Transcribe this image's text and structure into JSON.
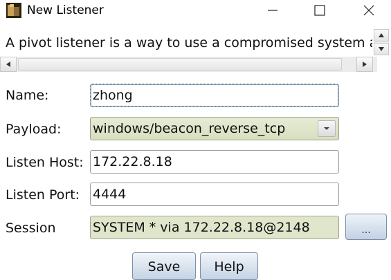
{
  "window": {
    "title": "New Listener"
  },
  "description": {
    "text": "A pivot listener is a way to use a compromised system as"
  },
  "form": {
    "name_label": "Name:",
    "name_value": "zhong",
    "payload_label": "Payload:",
    "payload_value": "windows/beacon_reverse_tcp",
    "listen_host_label": "Listen Host:",
    "listen_host_value": "172.22.8.18",
    "listen_port_label": "Listen Port:",
    "listen_port_value": "4444",
    "session_label": "Session",
    "session_value": "SYSTEM * via  172.22.8.18@2148",
    "session_browse_label": "..."
  },
  "buttons": {
    "save_label": "Save",
    "help_label": "Help"
  },
  "icons": {
    "app": "app-icon",
    "minimize": "minimize-icon",
    "maximize": "maximize-icon",
    "close": "close-icon",
    "dropdown": "chevron-down-icon"
  }
}
